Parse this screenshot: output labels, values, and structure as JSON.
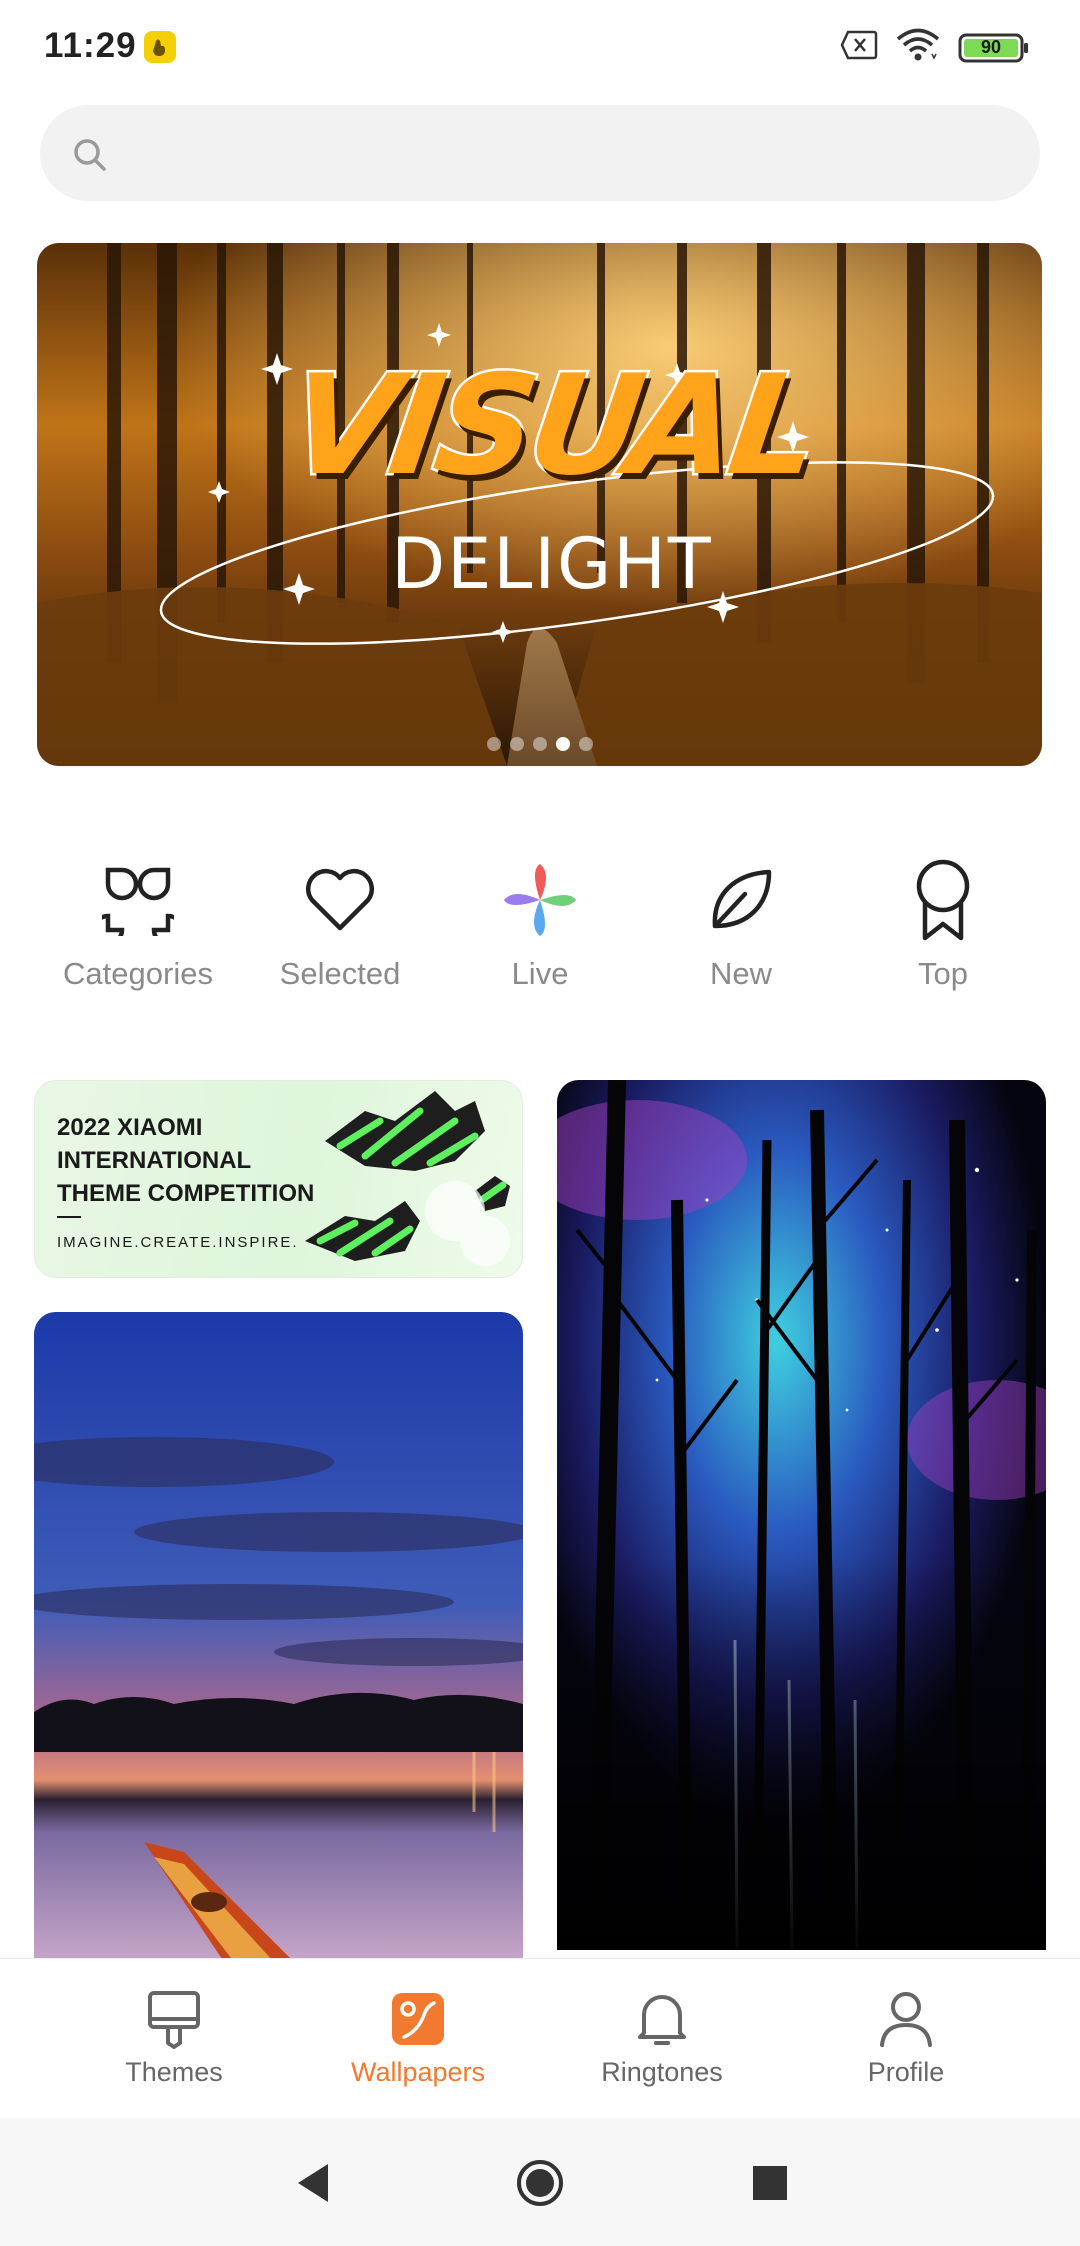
{
  "status_bar": {
    "time": "11:29",
    "battery": "90",
    "icons": [
      "notification-app-icon",
      "sim-off-icon",
      "wifi-icon",
      "battery-icon"
    ],
    "battery_color": "#7ed957"
  },
  "search": {
    "placeholder": "",
    "icon": "search-icon"
  },
  "banner": {
    "title": "VISUAL",
    "subtitle": "DELIGHT",
    "slide_count": 5,
    "active_slide": 4,
    "accent": "#ffa31a"
  },
  "categories": [
    {
      "label": "Categories",
      "icon": "grid-icon"
    },
    {
      "label": "Selected",
      "icon": "heart-icon"
    },
    {
      "label": "Live",
      "icon": "pinwheel-icon"
    },
    {
      "label": "New",
      "icon": "leaf-icon"
    },
    {
      "label": "Top",
      "icon": "award-icon"
    }
  ],
  "cards": {
    "competition": {
      "line1": "2022 XIAOMI",
      "line2": "INTERNATIONAL",
      "line3": "THEME COMPETITION",
      "tagline": "IMAGINE.CREATE.INSPIRE."
    }
  },
  "bottom_nav": {
    "items": [
      {
        "label": "Themes",
        "icon": "brush-icon"
      },
      {
        "label": "Wallpapers",
        "icon": "wallpaper-icon"
      },
      {
        "label": "Ringtones",
        "icon": "bell-icon"
      },
      {
        "label": "Profile",
        "icon": "person-icon"
      }
    ],
    "active_index": 1,
    "accent": "#f27a30"
  },
  "system_nav": [
    "back-icon",
    "home-icon",
    "recents-icon"
  ]
}
